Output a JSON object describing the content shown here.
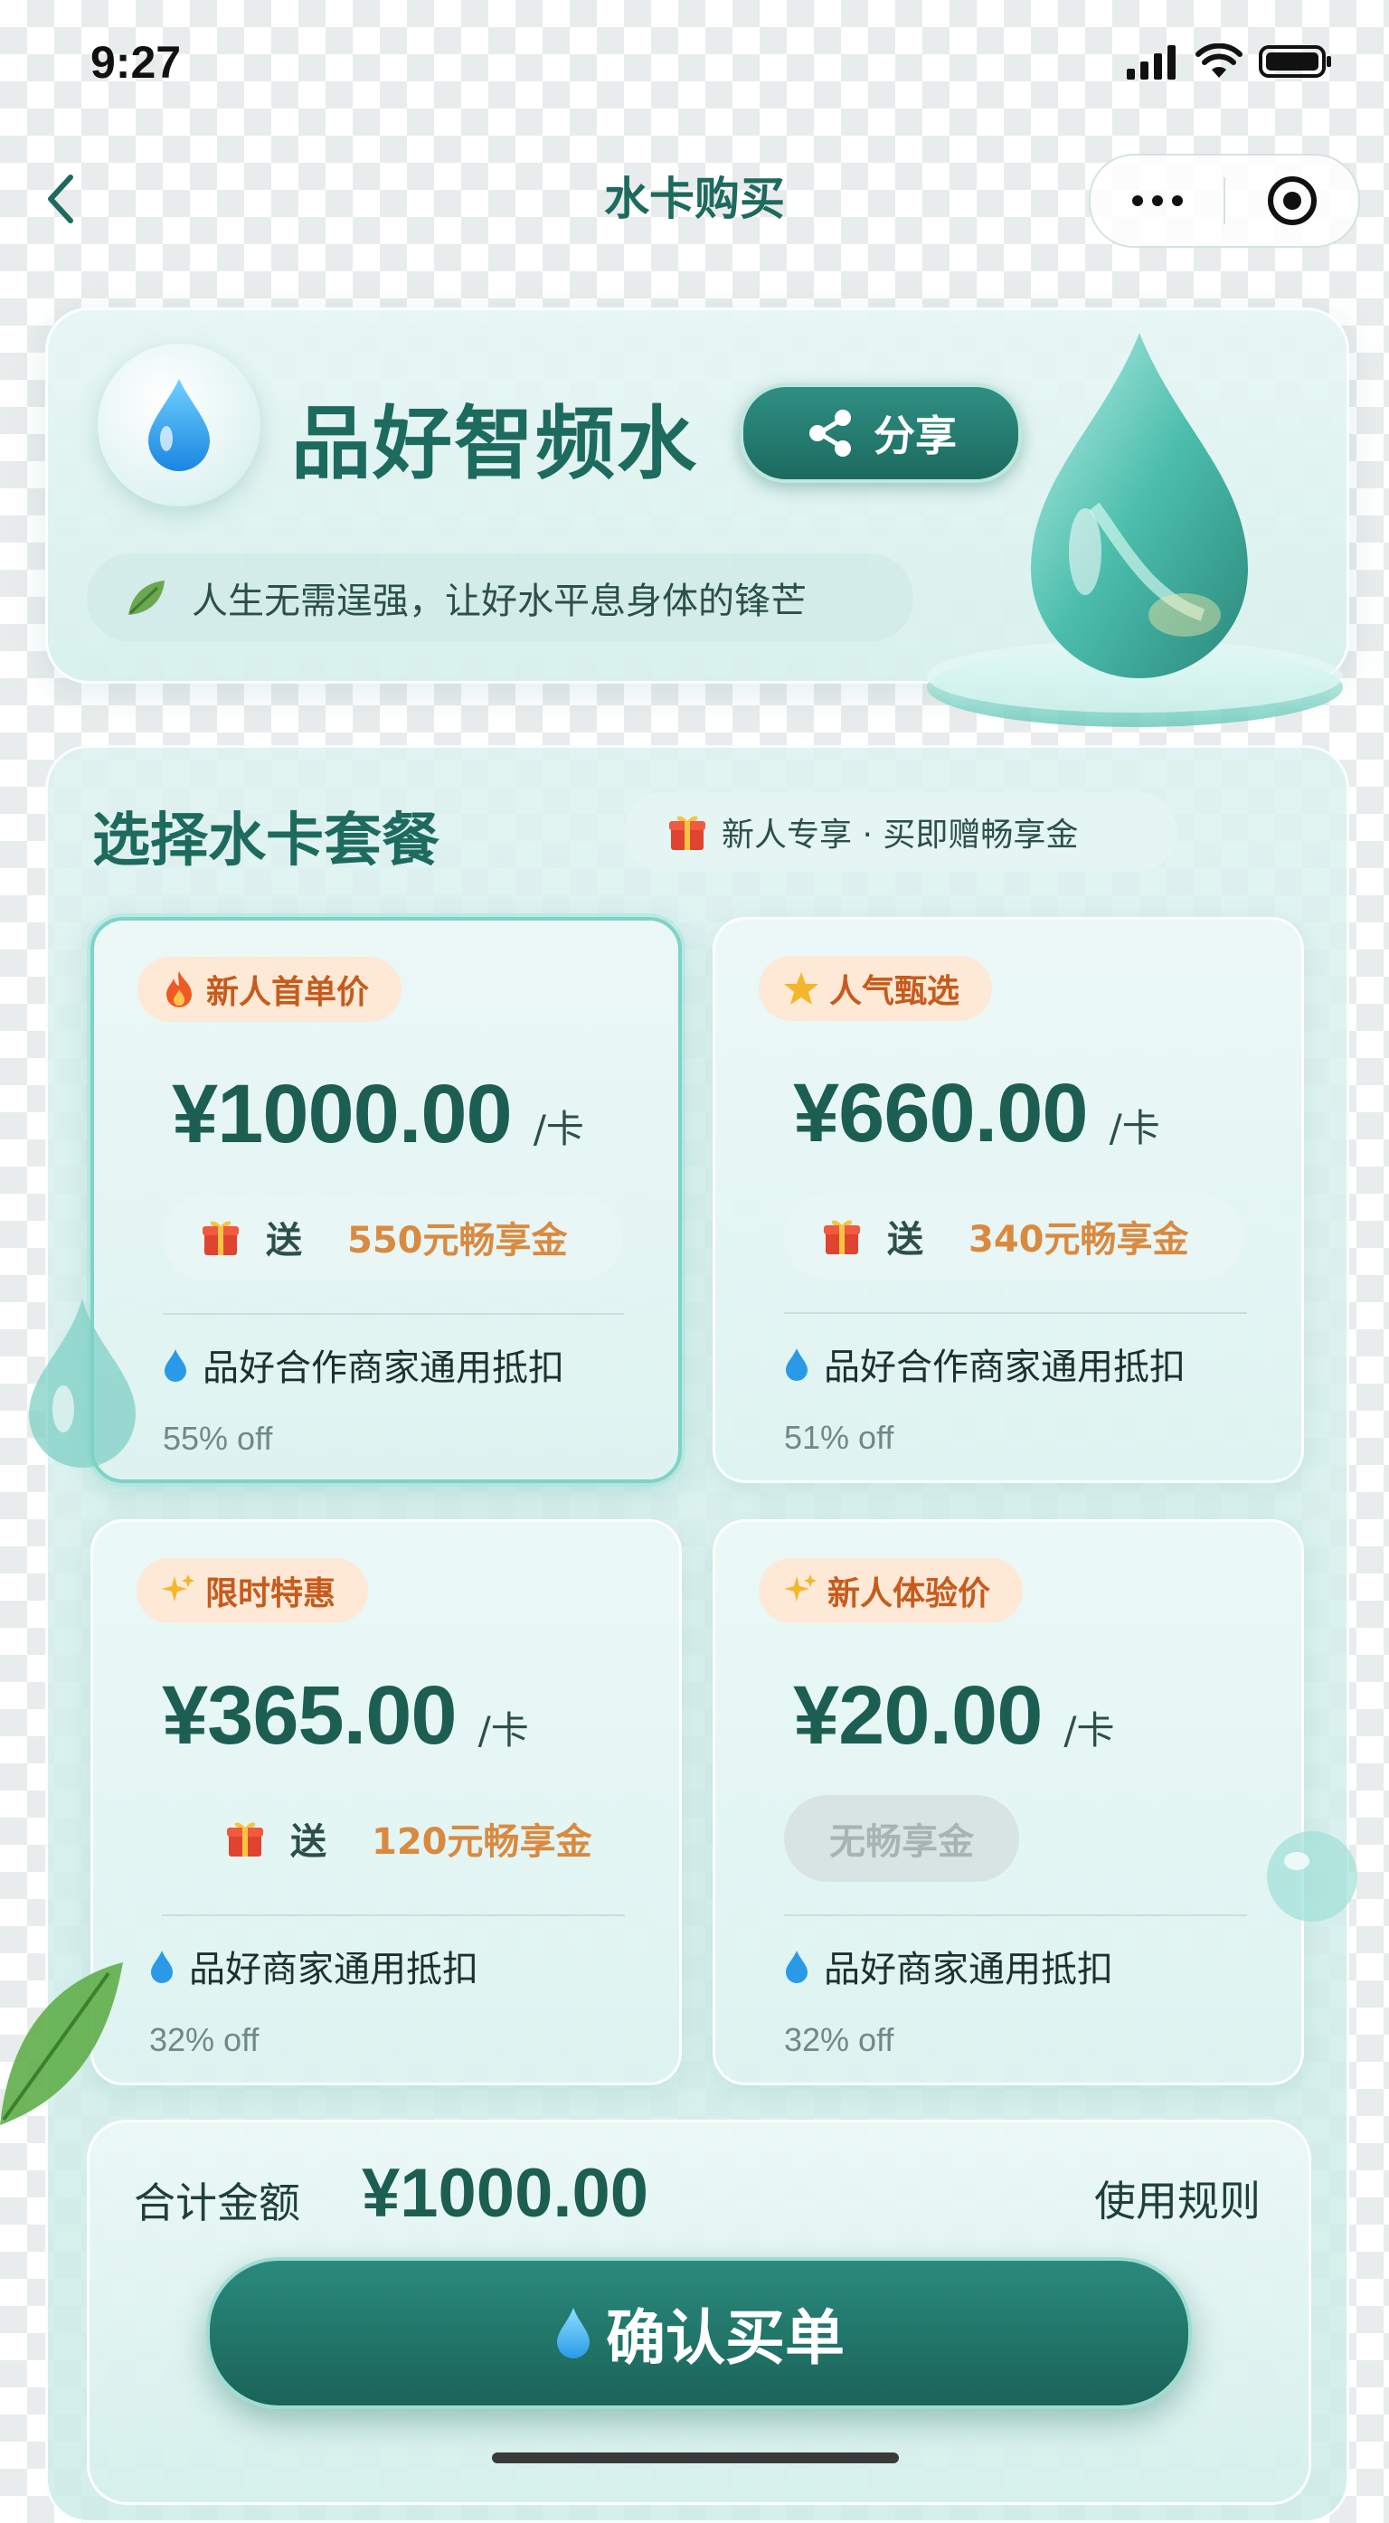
{
  "status_bar": {
    "time": "9:27"
  },
  "nav": {
    "title": "水卡购买"
  },
  "header": {
    "brand_name": "品好智频水",
    "share_label": "分享",
    "slogan": "人生无需逞强，让好水平息身体的锋芒"
  },
  "packages_section": {
    "title": "选择水卡套餐",
    "promo": "新人专享 · 买即赠畅享金"
  },
  "packages": [
    {
      "badge": "新人首单价",
      "badge_icon": "fire-icon",
      "price": "¥1000.00",
      "unit": "/卡",
      "gift_prefix": "送",
      "gift": "550元畅享金",
      "description": "品好合作商家通用抵扣",
      "discount": "55% off",
      "selected": true
    },
    {
      "badge": "人气甄选",
      "badge_icon": "star-icon",
      "price": "¥660.00",
      "unit": "/卡",
      "gift_prefix": "送",
      "gift": "340元畅享金",
      "description": "品好合作商家通用抵扣",
      "discount": "51% off",
      "selected": false
    },
    {
      "badge": "限时特惠",
      "badge_icon": "sparkle-icon",
      "price": "¥365.00",
      "unit": "/卡",
      "gift_prefix": "送",
      "gift": "120元畅享金",
      "description": "品好商家通用抵扣",
      "discount": "32% off",
      "selected": false
    },
    {
      "badge": "新人体验价",
      "badge_icon": "sparkle-icon",
      "price": "¥20.00",
      "unit": "/卡",
      "no_gift": "无畅享金",
      "description": "品好商家通用抵扣",
      "discount": "32% off",
      "selected": false
    }
  ],
  "footer": {
    "total_label": "合计金额",
    "total_value": "¥1000.00",
    "rules_label": "使用规则",
    "confirm_label": "确认买单"
  },
  "colors": {
    "primary": "#1d6a5e",
    "accent_orange": "#d98a3f",
    "badge_bg": "#fde9d6",
    "badge_text": "#c65b1c",
    "selected_border": "#7fd3c6"
  }
}
